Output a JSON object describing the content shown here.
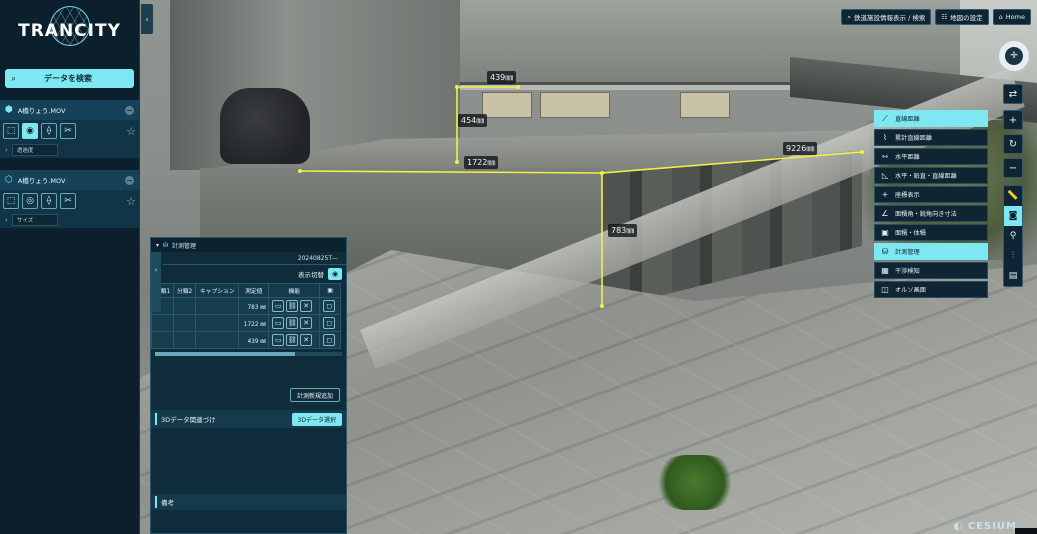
{
  "app": {
    "logo": "TRANCITY"
  },
  "sidebar": {
    "search_label": "データを検索",
    "files": [
      {
        "name": "A橋りょう.MOV",
        "sub_label": "透過度"
      },
      {
        "name": "A橋りょう.MOV",
        "sub_label": "サイズ"
      }
    ]
  },
  "topbar": {
    "facility_btn": "鉄道施設情報表示 / 検索",
    "map_btn": "地図の設定",
    "home_btn": "Home"
  },
  "measure_menu": [
    {
      "label": "直線距離",
      "icon": "ruler-icon"
    },
    {
      "label": "累計直線距離",
      "icon": "polyline-icon"
    },
    {
      "label": "水平距離",
      "icon": "horizontal-icon"
    },
    {
      "label": "水平・鉛直・直線距離",
      "icon": "triangle-icon"
    },
    {
      "label": "座標表示",
      "icon": "plus-icon"
    },
    {
      "label": "面積角・鋭角向き寸法",
      "icon": "angle-icon"
    },
    {
      "label": "面積・体積",
      "icon": "area-icon"
    },
    {
      "label": "計測管理",
      "icon": "database-icon"
    },
    {
      "label": "干渉検知",
      "icon": "interference-icon"
    },
    {
      "label": "オルソ画面",
      "icon": "ortho-icon"
    }
  ],
  "measurements": [
    {
      "label": "439㎜"
    },
    {
      "label": "454㎜"
    },
    {
      "label": "1722㎜"
    },
    {
      "label": "9226㎜"
    },
    {
      "label": "783㎜"
    }
  ],
  "panel": {
    "title": "計測管理",
    "date": "20240825T—",
    "toggle_label": "表示切替",
    "columns": [
      "分類1",
      "分類2",
      "キャプション",
      "測定値",
      "機能"
    ],
    "rows": [
      {
        "c1": "",
        "c2": "",
        "caption": "",
        "value": "783 ㎜"
      },
      {
        "c1": "",
        "c2": "",
        "caption": "",
        "value": "1722 ㎜"
      },
      {
        "c1": "",
        "c2": "",
        "caption": "",
        "value": "439 ㎜"
      }
    ],
    "list_btn": "計測新規追加",
    "assoc_label": "3Dデータ関連づけ",
    "assoc_btn": "3Dデータ選択",
    "notes_label": "備考"
  },
  "footer": {
    "cesium": "CESIUM"
  }
}
